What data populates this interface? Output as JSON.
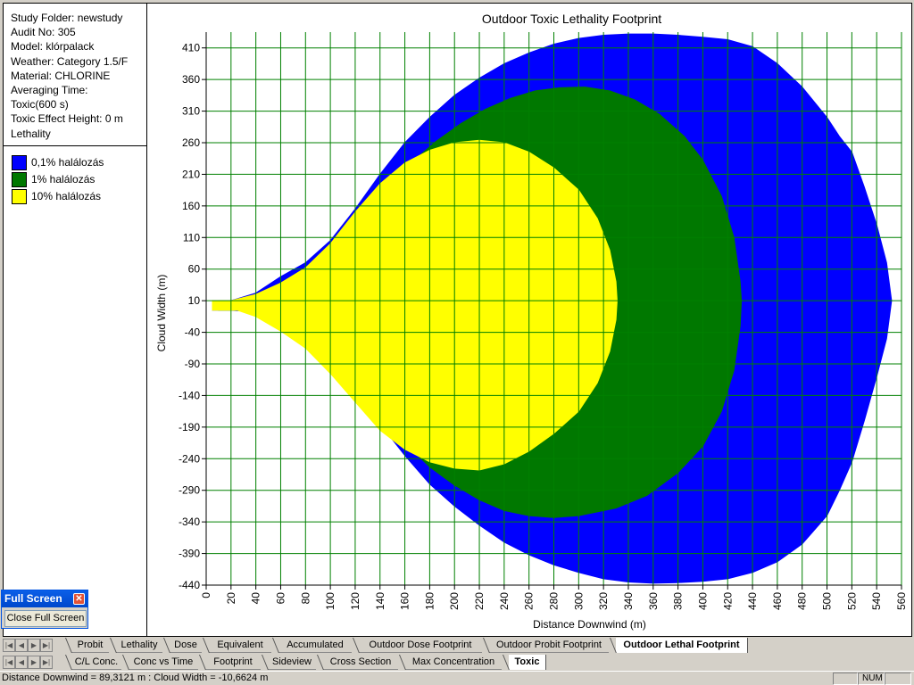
{
  "info": {
    "lines": [
      "Study Folder: newstudy",
      "Audit No: 305",
      "Model: klórpalack",
      "Weather: Category 1.5/F",
      "Material: CHLORINE",
      "Averaging Time:",
      "Toxic(600 s)",
      "Toxic Effect Height: 0 m",
      "Lethality"
    ]
  },
  "legend": [
    {
      "label": "0,1% halálozás",
      "color": "#0000ff"
    },
    {
      "label": "1% halálozás",
      "color": "#007800"
    },
    {
      "label": "10% halálozás",
      "color": "#ffff00"
    }
  ],
  "chart_data": {
    "type": "area",
    "title": "Outdoor Toxic Lethality Footprint",
    "xlabel": "Distance Downwind (m)",
    "ylabel": "Cloud Width (m)",
    "xlim": [
      0,
      560
    ],
    "ylim": [
      -440,
      435
    ],
    "x_ticks": [
      0,
      20,
      40,
      60,
      80,
      100,
      120,
      140,
      160,
      180,
      200,
      220,
      240,
      260,
      280,
      300,
      320,
      340,
      360,
      380,
      400,
      420,
      440,
      460,
      480,
      500,
      520,
      540,
      560
    ],
    "y_ticks": [
      410,
      360,
      310,
      260,
      210,
      160,
      110,
      60,
      10,
      -40,
      -90,
      -140,
      -190,
      -240,
      -290,
      -340,
      -390,
      -440
    ],
    "grid": true,
    "series": [
      {
        "name": "0,1% halálozás",
        "color": "#0000ff",
        "points": [
          [
            5,
            10
          ],
          [
            20,
            10
          ],
          [
            40,
            22
          ],
          [
            60,
            48
          ],
          [
            80,
            70
          ],
          [
            100,
            105
          ],
          [
            120,
            155
          ],
          [
            140,
            210
          ],
          [
            160,
            260
          ],
          [
            180,
            300
          ],
          [
            200,
            335
          ],
          [
            220,
            362
          ],
          [
            240,
            385
          ],
          [
            260,
            402
          ],
          [
            280,
            416
          ],
          [
            300,
            425
          ],
          [
            320,
            430
          ],
          [
            340,
            432
          ],
          [
            360,
            432
          ],
          [
            380,
            430
          ],
          [
            400,
            427
          ],
          [
            420,
            423
          ],
          [
            440,
            412
          ],
          [
            460,
            385
          ],
          [
            480,
            348
          ],
          [
            500,
            300
          ],
          [
            510,
            270
          ],
          [
            520,
            245
          ],
          [
            530,
            190
          ],
          [
            540,
            130
          ],
          [
            548,
            70
          ],
          [
            552,
            10
          ],
          [
            548,
            -50
          ],
          [
            540,
            -110
          ],
          [
            530,
            -180
          ],
          [
            520,
            -245
          ],
          [
            510,
            -290
          ],
          [
            500,
            -330
          ],
          [
            480,
            -375
          ],
          [
            460,
            -403
          ],
          [
            440,
            -420
          ],
          [
            420,
            -430
          ],
          [
            400,
            -434
          ],
          [
            380,
            -436
          ],
          [
            360,
            -437
          ],
          [
            340,
            -435
          ],
          [
            320,
            -430
          ],
          [
            300,
            -420
          ],
          [
            280,
            -408
          ],
          [
            260,
            -392
          ],
          [
            240,
            -372
          ],
          [
            220,
            -345
          ],
          [
            200,
            -315
          ],
          [
            180,
            -280
          ],
          [
            160,
            -235
          ],
          [
            140,
            -185
          ],
          [
            120,
            -128
          ],
          [
            100,
            -80
          ],
          [
            80,
            -48
          ],
          [
            60,
            -25
          ],
          [
            40,
            -8
          ],
          [
            20,
            -5
          ],
          [
            5,
            -5
          ]
        ]
      },
      {
        "name": "1% halálozás",
        "color": "#007800",
        "points": [
          [
            10,
            10
          ],
          [
            25,
            10
          ],
          [
            45,
            18
          ],
          [
            65,
            38
          ],
          [
            85,
            60
          ],
          [
            105,
            92
          ],
          [
            125,
            138
          ],
          [
            145,
            185
          ],
          [
            165,
            228
          ],
          [
            185,
            262
          ],
          [
            205,
            290
          ],
          [
            225,
            313
          ],
          [
            245,
            330
          ],
          [
            265,
            342
          ],
          [
            285,
            347
          ],
          [
            305,
            348
          ],
          [
            325,
            342
          ],
          [
            345,
            328
          ],
          [
            365,
            305
          ],
          [
            385,
            270
          ],
          [
            400,
            232
          ],
          [
            415,
            175
          ],
          [
            425,
            110
          ],
          [
            430,
            40
          ],
          [
            431,
            10
          ],
          [
            430,
            -30
          ],
          [
            425,
            -100
          ],
          [
            415,
            -165
          ],
          [
            400,
            -220
          ],
          [
            380,
            -262
          ],
          [
            355,
            -298
          ],
          [
            330,
            -318
          ],
          [
            300,
            -330
          ],
          [
            280,
            -333
          ],
          [
            260,
            -330
          ],
          [
            240,
            -322
          ],
          [
            220,
            -305
          ],
          [
            200,
            -282
          ],
          [
            180,
            -253
          ],
          [
            160,
            -215
          ],
          [
            140,
            -170
          ],
          [
            120,
            -120
          ],
          [
            100,
            -75
          ],
          [
            80,
            -45
          ],
          [
            60,
            -25
          ],
          [
            40,
            -8
          ],
          [
            25,
            -5
          ],
          [
            10,
            -5
          ]
        ]
      },
      {
        "name": "10% halálozás",
        "color": "#ffff00",
        "points": [
          [
            5,
            10
          ],
          [
            20,
            10
          ],
          [
            40,
            20
          ],
          [
            60,
            38
          ],
          [
            80,
            62
          ],
          [
            100,
            100
          ],
          [
            120,
            150
          ],
          [
            140,
            195
          ],
          [
            160,
            228
          ],
          [
            180,
            248
          ],
          [
            200,
            260
          ],
          [
            220,
            264
          ],
          [
            240,
            260
          ],
          [
            260,
            245
          ],
          [
            280,
            220
          ],
          [
            300,
            185
          ],
          [
            315,
            140
          ],
          [
            325,
            90
          ],
          [
            330,
            40
          ],
          [
            331,
            10
          ],
          [
            330,
            -20
          ],
          [
            325,
            -70
          ],
          [
            315,
            -120
          ],
          [
            300,
            -165
          ],
          [
            280,
            -200
          ],
          [
            260,
            -228
          ],
          [
            240,
            -248
          ],
          [
            220,
            -258
          ],
          [
            200,
            -255
          ],
          [
            180,
            -245
          ],
          [
            160,
            -225
          ],
          [
            140,
            -195
          ],
          [
            120,
            -150
          ],
          [
            100,
            -105
          ],
          [
            80,
            -65
          ],
          [
            60,
            -38
          ],
          [
            40,
            -15
          ],
          [
            25,
            -5
          ],
          [
            5,
            -5
          ]
        ]
      }
    ]
  },
  "fullscreen": {
    "title": "Full Screen",
    "button": "Close Full Screen"
  },
  "tabs_row1": [
    "Probit",
    "Lethality",
    "Dose",
    "Equivalent",
    "Accumulated",
    "Outdoor Dose Footprint",
    "Outdoor Probit Footprint",
    "Outdoor Lethal Footprint"
  ],
  "tabs_row2": [
    "C/L Conc.",
    "Conc vs Time",
    "Footprint",
    "Sideview",
    "Cross Section",
    "Max Concentration",
    "Toxic"
  ],
  "status": {
    "text": "Distance Downwind = 89,3121 m : Cloud Width = -10,6624 m",
    "num": "NUM"
  }
}
